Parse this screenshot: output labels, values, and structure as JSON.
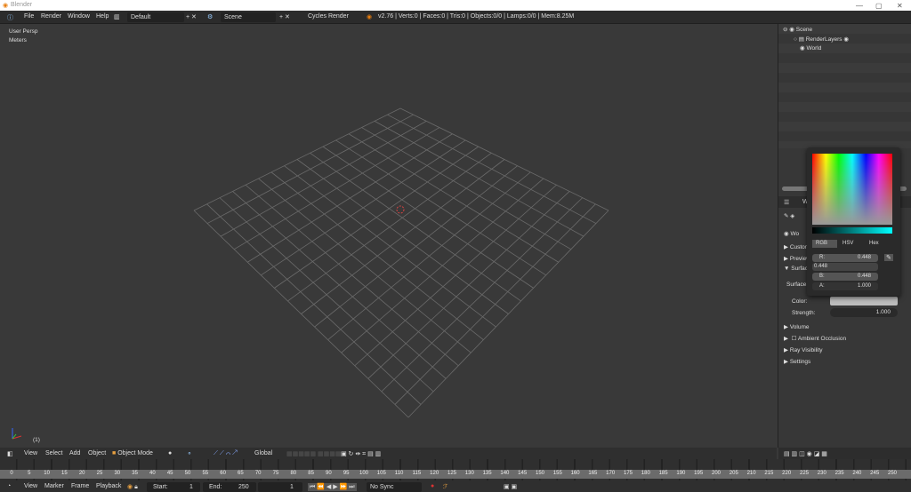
{
  "window": {
    "title": "Blender"
  },
  "infobar": {
    "menus": [
      "File",
      "Render",
      "Window",
      "Help"
    ],
    "layout": "Default",
    "scene": "Scene",
    "engine": "Cycles Render",
    "stats": "v2.76 | Verts:0 | Faces:0 | Tris:0 | Objects:0/0 | Lamps:0/0 | Mem:8.25M"
  },
  "viewport": {
    "view_name": "User Persp",
    "units": "Meters",
    "frame": "(1)"
  },
  "view3d_header": {
    "menus": [
      "View",
      "Select",
      "Add",
      "Object"
    ],
    "mode": "Object Mode",
    "orientation": "Global"
  },
  "outliner": {
    "items": [
      "Scene",
      "RenderLayers",
      "World"
    ]
  },
  "properties": {
    "tab_label": "W",
    "world_field": "Wo",
    "panels": [
      "Custom",
      "Preview",
      "Surface"
    ],
    "surface_label": "Surface:",
    "color_label": "Color:",
    "strength_label": "Strength:",
    "strength_value": "1.000",
    "sections": [
      "Volume",
      "Ambient Occlusion",
      "Ray Visibility",
      "Settings"
    ]
  },
  "color_picker": {
    "tabs": [
      "RGB",
      "HSV",
      "Hex"
    ],
    "active_tab": "RGB",
    "r_label": "R:",
    "r": "0.448",
    "g_edit": "0.448",
    "b_label": "B:",
    "b": "0.448",
    "a_label": "A:",
    "a": "1.000",
    "color_value": "#727272"
  },
  "timeline": {
    "ticks": [
      0,
      5,
      10,
      15,
      20,
      25,
      30,
      35,
      40,
      45,
      50,
      55,
      60,
      65,
      70,
      75,
      80,
      85,
      90,
      95,
      100,
      105,
      110,
      115,
      120,
      125,
      130,
      135,
      140,
      145,
      150,
      155,
      160,
      165,
      170,
      175,
      180,
      185,
      190,
      195,
      200,
      205,
      210,
      215,
      220,
      225,
      230,
      235,
      240,
      245,
      250
    ],
    "menus": [
      "View",
      "Marker",
      "Frame",
      "Playback"
    ],
    "start_label": "Start:",
    "start": "1",
    "end_label": "End:",
    "end": "250",
    "current": "1",
    "sync": "No Sync"
  }
}
